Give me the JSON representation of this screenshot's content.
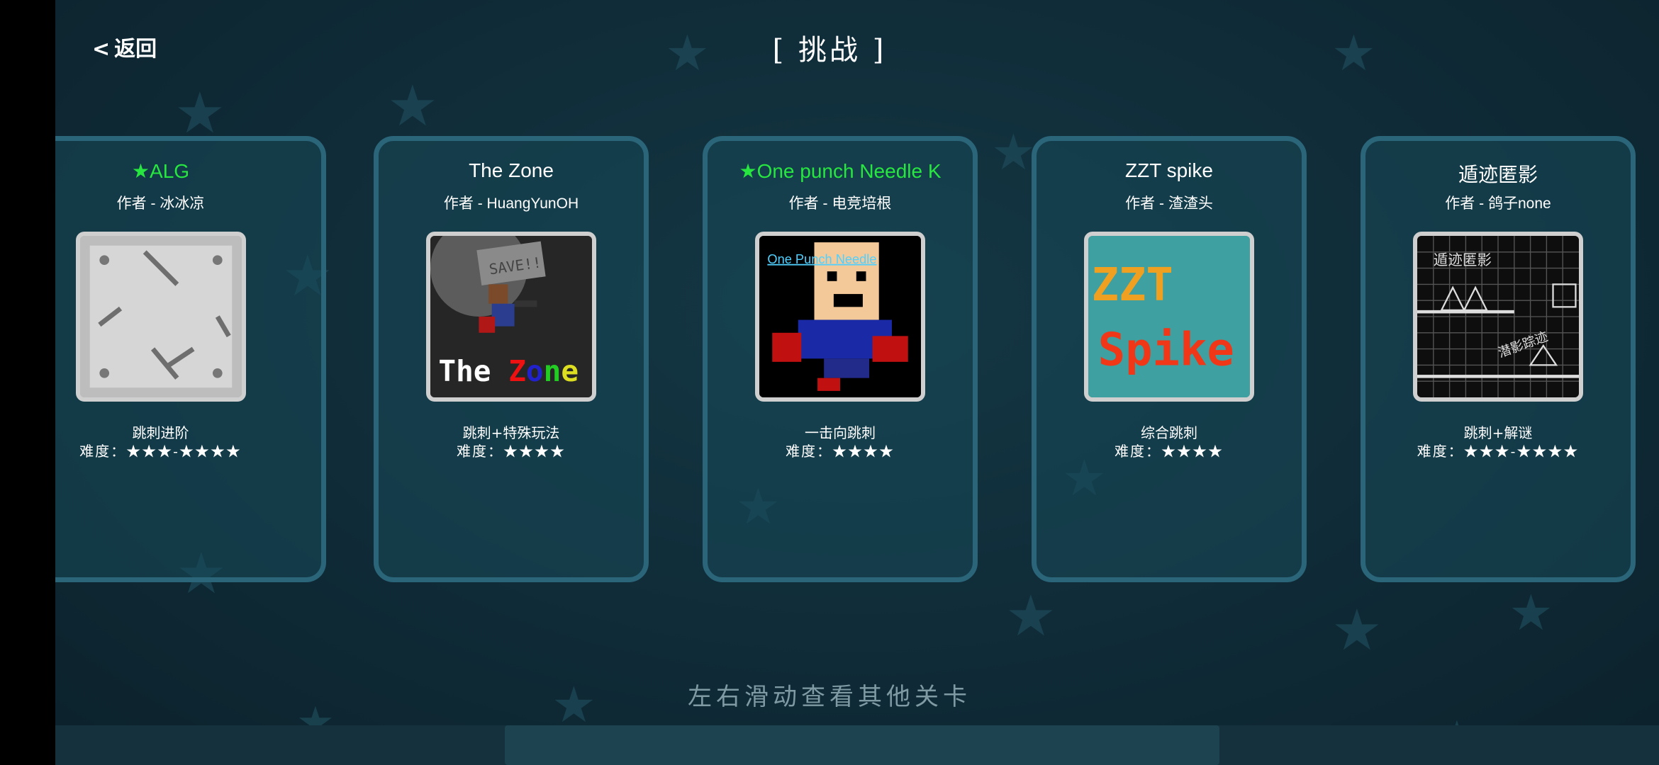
{
  "header": {
    "back_label": "返回",
    "back_chevron": "<",
    "title": "[ 挑战 ]"
  },
  "cards": [
    {
      "title": "ALG",
      "featured": true,
      "author": "作者 - 冰冰凉",
      "category": "跳刺进阶",
      "difficulty": "难度：★★★-★★★★",
      "thumb_icon": "stone-tile-thumbnail"
    },
    {
      "title": "The Zone",
      "featured": false,
      "author": "作者 - HuangYunOH",
      "category": "跳刺+特殊玩法",
      "difficulty": "难度：★★★★",
      "thumb_icon": "the-zone-thumbnail",
      "thumb_text": [
        "The ",
        "Z",
        "o",
        "n",
        "e"
      ],
      "thumb_sign": "SAVE!!"
    },
    {
      "title": "One punch Needle K",
      "featured": true,
      "author": "作者 - 电竞培根",
      "category": "一击向跳刺",
      "difficulty": "难度：★★★★",
      "thumb_icon": "one-punch-thumbnail",
      "thumb_text": "One Punch Needle"
    },
    {
      "title": "ZZT spike",
      "featured": false,
      "author": "作者 - 渣渣头",
      "category": "综合跳刺",
      "difficulty": "难度：★★★★",
      "thumb_icon": "zzt-spike-thumbnail",
      "thumb_text": [
        "ZZT",
        "Spike"
      ]
    },
    {
      "title": "遁迹匿影",
      "featured": false,
      "author": "作者 - 鸽子none",
      "category": "跳刺+解谜",
      "difficulty": "难度：★★★-★★★★",
      "thumb_icon": "grid-level-thumbnail",
      "thumb_text": [
        "遁迹匿影",
        "潜影踪迹"
      ]
    }
  ],
  "featured_star": "★",
  "hint": "左右滑动查看其他关卡",
  "colors": {
    "featured": "#27e640",
    "card_border": "#2b6579",
    "background": "#0f2330"
  }
}
